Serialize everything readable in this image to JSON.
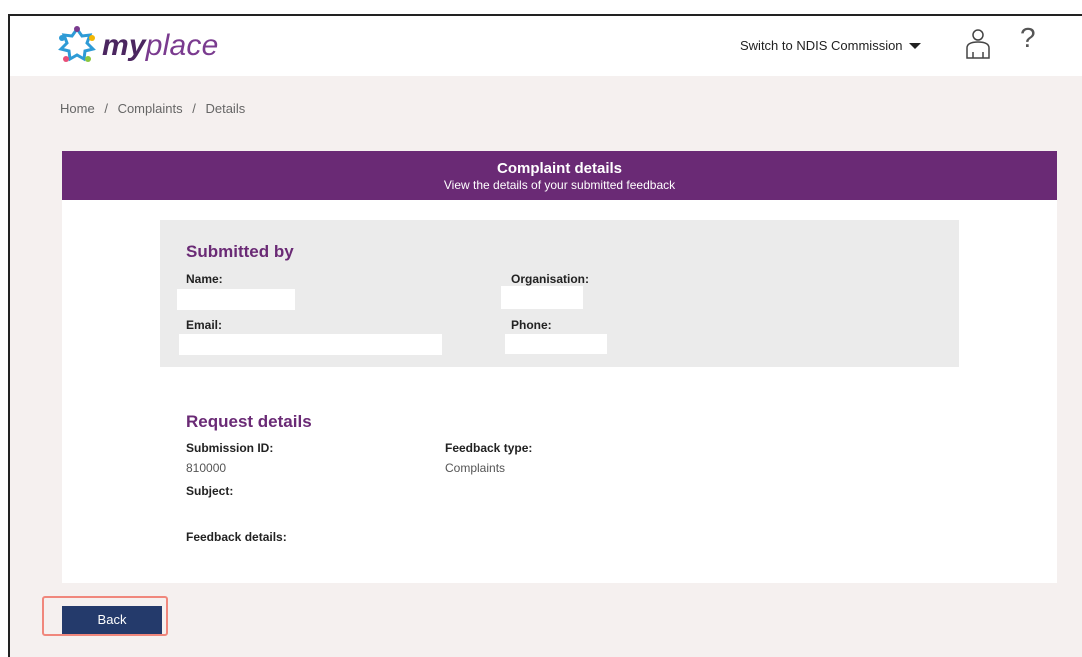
{
  "header": {
    "logo_text_bold": "my",
    "logo_text_rest": "place",
    "switch_label": "Switch to NDIS Commission",
    "help_symbol": "?"
  },
  "breadcrumb": {
    "items": [
      "Home",
      "Complaints",
      "Details"
    ],
    "separator": "/"
  },
  "card": {
    "title": "Complaint details",
    "subtitle": "View the details of your submitted feedback"
  },
  "submitted_by": {
    "title": "Submitted by",
    "name_label": "Name:",
    "organisation_label": "Organisation:",
    "email_label": "Email:",
    "phone_label": "Phone:"
  },
  "request_details": {
    "title": "Request details",
    "submission_id_label": "Submission ID:",
    "submission_id_value": "810000",
    "feedback_type_label": "Feedback type:",
    "feedback_type_value": "Complaints",
    "subject_label": "Subject:",
    "feedback_details_label": "Feedback details:"
  },
  "actions": {
    "back_label": "Back"
  },
  "colors": {
    "brand_purple": "#6a2a75",
    "back_button": "#243a6b",
    "highlight": "#f0877c",
    "page_bg": "#f5f0ef"
  }
}
